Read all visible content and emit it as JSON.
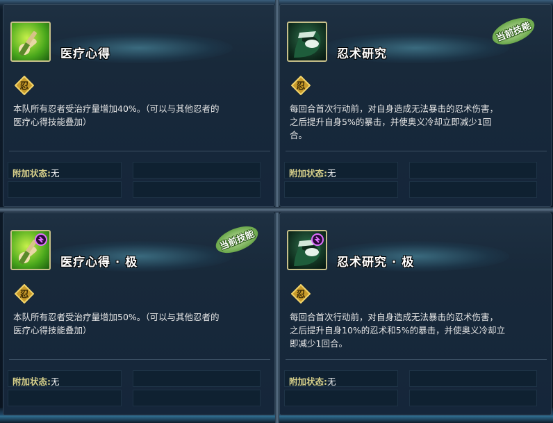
{
  "cards": [
    {
      "name": "医疗心得",
      "description_line1": "本队所有忍者受治疗量增加40%。（可以与其他忍者的",
      "description_line2": "医疗心得技能叠加）",
      "description_line3": "",
      "extra_label": "附加状态:",
      "extra_value": "无",
      "icon": "medical-scroll-icon",
      "current": false
    },
    {
      "name": "忍术研究",
      "description_line1": "每回合首次行动前，对自身造成无法暴击的忍术伤害，",
      "description_line2": "之后提升自身5%的暴击，并使奥义冷却立即减少1回",
      "description_line3": "合。",
      "extra_label": "附加状态:",
      "extra_value": "无",
      "icon": "masked-ninja-icon",
      "current": true
    },
    {
      "name": "医疗心得 · 极",
      "description_line1": "本队所有忍者受治疗量增加50%。（可以与其他忍者的",
      "description_line2": "医疗心得技能叠加）",
      "description_line3": "",
      "extra_label": "附加状态:",
      "extra_value": "无",
      "icon": "medical-scroll-icon",
      "current": true
    },
    {
      "name": "忍术研究 · 极",
      "description_line1": "每回合首次行动前，对自身造成无法暴击的忍术伤害，",
      "description_line2": "之后提升自身10%的忍术和5%的暴击，并使奥义冷却立",
      "description_line3": "即减少1回合。",
      "extra_label": "附加状态:",
      "extra_value": "无",
      "icon": "masked-ninja-icon",
      "current": false
    }
  ],
  "badge_label": "当前技能",
  "ninja_mark_glyph": "忍",
  "colors": {
    "badge_green": "#6fae4c",
    "label_gold": "#d6cf8a",
    "panel_bg": "#15263a"
  }
}
